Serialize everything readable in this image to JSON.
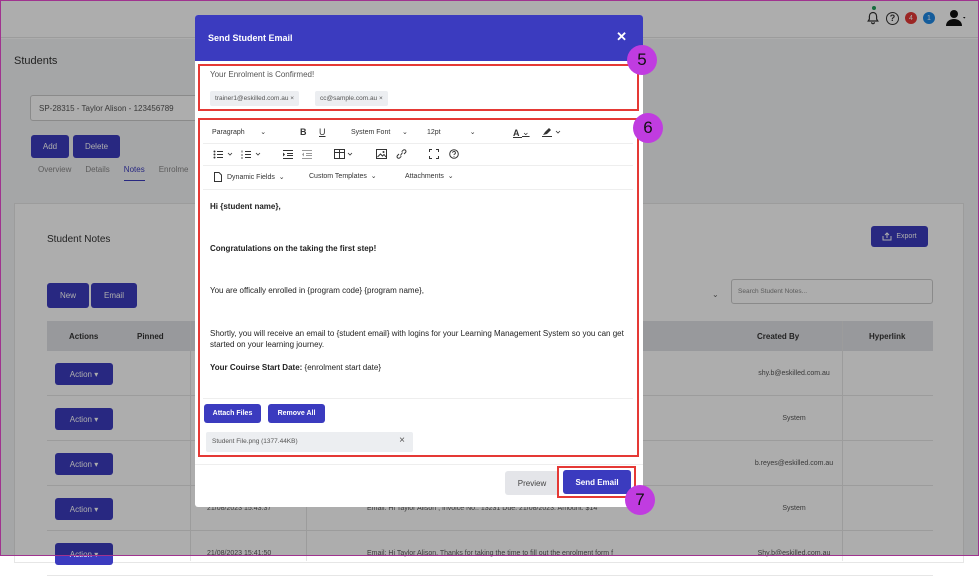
{
  "topbar": {
    "badge_red": "4",
    "badge_blue": "1",
    "help_glyph": "?"
  },
  "page": {
    "title": "Students",
    "student_select": "SP-28315 - Taylor Alison - 123456789",
    "add_label": "Add",
    "delete_label": "Delete",
    "tabs": [
      "Overview",
      "Details",
      "Notes",
      "Enrolme"
    ],
    "notes_title": "Student Notes",
    "export_label": "Export",
    "new_label": "New",
    "email_label": "Email",
    "search_placeholder": "Search Student Notes...",
    "columns": {
      "actions": "Actions",
      "pinned": "Pinned",
      "created_by": "Created By",
      "hyperlink": "Hyperlink"
    },
    "action_label": "Action",
    "rows": [
      {
        "date": "",
        "email": "",
        "by": "shy.b@eskilled.com.au"
      },
      {
        "date": "",
        "email": "",
        "by": "System"
      },
      {
        "date": "",
        "email": "",
        "by": "b.reyes@eskilled.com.au"
      },
      {
        "date": "21/08/2023 15:43:37",
        "email": "Email: Hi Taylor Alison , Invoice No.: 13231 Due: 21/08/2023. Amount: $14",
        "by": "System"
      },
      {
        "date": "21/08/2023 15:41:50",
        "email": "Email: Hi Taylor Alison, Thanks for taking the time to fill out the enrolment form f",
        "by": "Shy.b@eskilled.com.au"
      }
    ]
  },
  "modal": {
    "title": "Send Student Email",
    "close_glyph": "✕",
    "subject": "Your Enrolment is Confirmed!",
    "recipients": [
      "trainer1@eskilled.com.au",
      "cc@sample.com.au"
    ],
    "toolbar": {
      "format": "Paragraph",
      "bold": "B",
      "underline": "U",
      "font": "System Font",
      "size": "12pt",
      "text_color": "A",
      "dynamic_fields": "Dynamic Fields",
      "custom_templates": "Custom Templates",
      "attachments": "Attachments"
    },
    "body": {
      "greeting": "Hi {student name},",
      "congrats": "Congratulations on the taking the first step!",
      "enrolled": "You are offically enrolled in {program code} {program name},",
      "shortly": "Shortly, you will receive an email to {student email} with logins for your Learning Management System so you can get started on your learning journey.",
      "start_label": "Your Couirse Start Date:",
      "start_value": " {enrolment start date}"
    },
    "attach_files": "Attach Files",
    "remove_all": "Remove All",
    "file": "Student File.png (1377.44KB)",
    "preview": "Preview",
    "send": "Send Email"
  },
  "callouts": [
    "5",
    "6",
    "7"
  ],
  "colors": {
    "primary": "#3b3bbf",
    "callout": "#c03ce0",
    "highlight": "#e53935",
    "badge_red": "#e53935",
    "badge_blue": "#1e88e5"
  },
  "icons": [
    "bell-icon",
    "help-icon",
    "user-icon",
    "close-icon",
    "bullet-list-icon",
    "numbered-list-icon",
    "indent-icon",
    "outdent-icon",
    "table-icon",
    "image-icon",
    "link-icon",
    "fullscreen-icon",
    "help-circle-icon",
    "file-icon",
    "export-icon"
  ]
}
